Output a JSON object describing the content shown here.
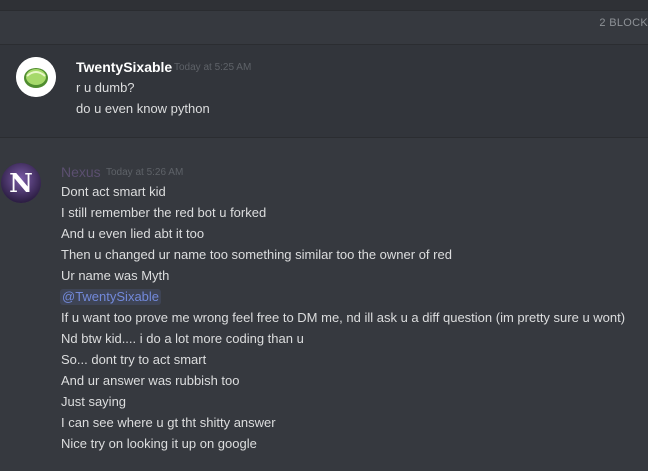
{
  "blocked_banner": {
    "label": "2 BLOCK"
  },
  "message_a": {
    "author": "TwentySixable",
    "timestamp": "Today at 5:25 AM",
    "lines": [
      "r u dumb?",
      "do u even know python"
    ]
  },
  "message_b": {
    "author": "Nexus",
    "avatar_letter": "N",
    "timestamp": "Today at 5:26 AM",
    "lines": [
      "Dont act smart kid",
      "I still remember the red bot u forked",
      "And u even lied abt it too",
      "Then u changed ur name too something similar too the  owner of red",
      "Ur name was Myth",
      "@TwentySixable",
      "If u want too prove me wrong feel free to DM me, nd ill ask u a diff question (im pretty sure u wont)",
      "Nd btw kid.... i do a lot more coding than u",
      "So... dont try to act smart",
      "And ur answer was rubbish too",
      "Just saying",
      "I can see where u gt tht shitty answer",
      "Nice  try on looking it up on google"
    ]
  },
  "colors": {
    "background": "#36393f",
    "mention": "#7289da",
    "text": "#dcddde"
  }
}
